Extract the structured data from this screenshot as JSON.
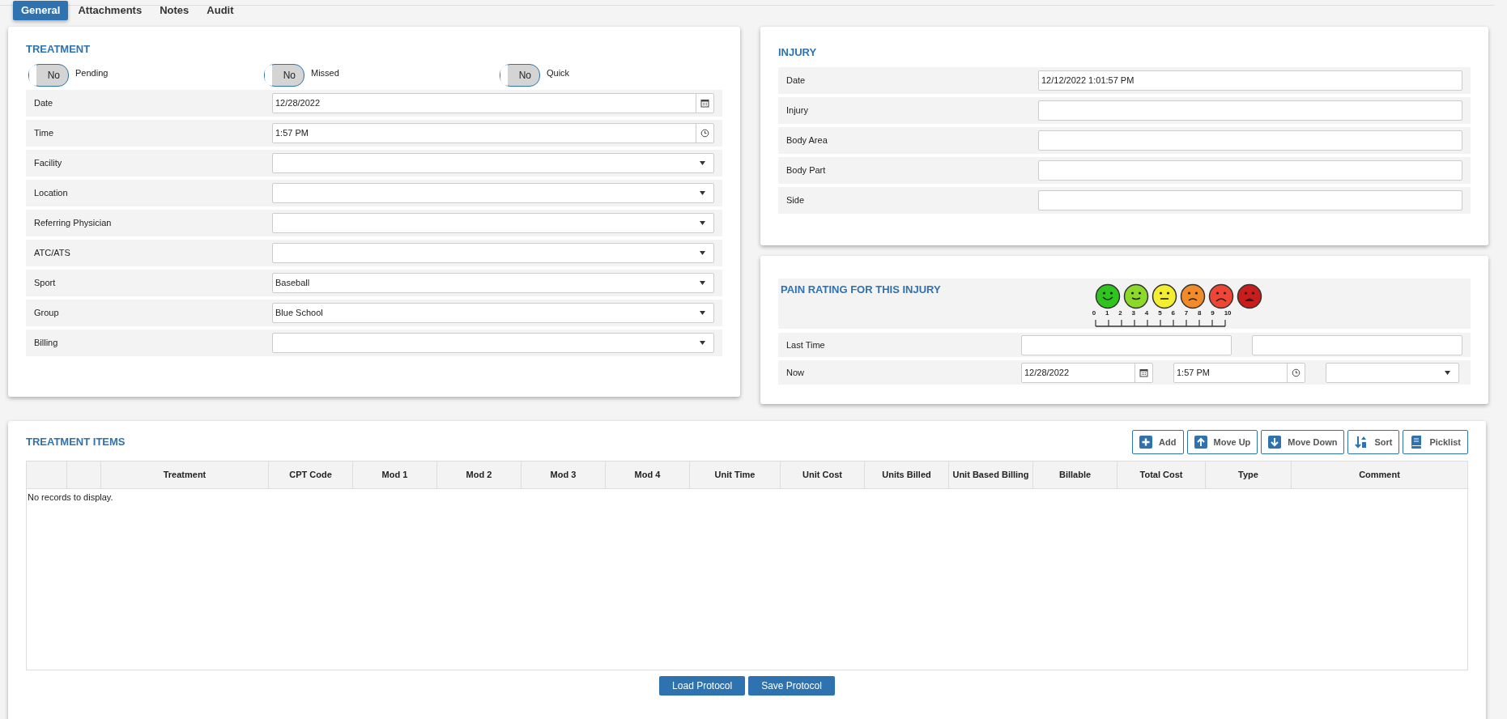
{
  "tabs": [
    {
      "label": "General",
      "selected": true
    },
    {
      "label": "Attachments",
      "selected": false
    },
    {
      "label": "Notes",
      "selected": false
    },
    {
      "label": "Audit",
      "selected": false
    }
  ],
  "treatment": {
    "title": "TREATMENT",
    "toggles": [
      {
        "value": "No",
        "on": false,
        "label": "Pending"
      },
      {
        "value": "No",
        "on": false,
        "label": "Missed"
      },
      {
        "value": "No",
        "on": false,
        "label": "Quick"
      }
    ],
    "fields": [
      {
        "label": "Date",
        "kind": "date",
        "value": "12/28/2022"
      },
      {
        "label": "Time",
        "kind": "time",
        "value": "1:57 PM"
      },
      {
        "label": "Facility",
        "kind": "select"
      },
      {
        "label": "Location",
        "kind": "select"
      },
      {
        "label": "Referring Physician",
        "kind": "select"
      },
      {
        "label": "ATC/ATS",
        "kind": "select"
      },
      {
        "label": "Sport",
        "kind": "select",
        "value": "Baseball"
      },
      {
        "label": "Group",
        "kind": "select",
        "value": "Blue School"
      },
      {
        "label": "Billing",
        "kind": "select"
      }
    ]
  },
  "injury": {
    "title": "INJURY",
    "fields": [
      {
        "label": "Date",
        "value": "12/12/2022 1:01:57 PM"
      },
      {
        "label": "Injury"
      },
      {
        "label": "Body Area"
      },
      {
        "label": "Body Part"
      },
      {
        "label": "Side"
      }
    ]
  },
  "pain": {
    "title": "PAIN RATING FOR THIS INJURY",
    "faces": [
      {
        "kind": "happy",
        "color": "#2fc41e"
      },
      {
        "kind": "smile",
        "color": "#8cd92a"
      },
      {
        "kind": "neutral",
        "color": "#f4ee30"
      },
      {
        "kind": "frown",
        "color": "#f28a27"
      },
      {
        "kind": "sad",
        "color": "#ef4535"
      },
      {
        "kind": "cry",
        "color": "#c91d1d"
      }
    ],
    "scale": [
      "0",
      "1",
      "2",
      "3",
      "4",
      "5",
      "6",
      "7",
      "8",
      "9",
      "10"
    ],
    "rows": [
      {
        "label": "Last Time",
        "inputs": [
          {
            "kind": "text"
          },
          {
            "kind": "text"
          }
        ]
      },
      {
        "label": "Now",
        "inputs": [
          {
            "kind": "date",
            "value": "12/28/2022"
          },
          {
            "kind": "time",
            "value": "1:57 PM"
          },
          {
            "kind": "select"
          }
        ]
      }
    ]
  },
  "items": {
    "title": "TREATMENT ITEMS",
    "buttons": [
      {
        "label": "Add",
        "kind": "add"
      },
      {
        "label": "Move Up",
        "kind": "up"
      },
      {
        "label": "Move Down",
        "kind": "down"
      },
      {
        "label": "Sort",
        "kind": "sort"
      },
      {
        "label": "Picklist",
        "kind": "book"
      }
    ],
    "columns": [
      "Treatment",
      "CPT Code",
      "Mod 1",
      "Mod 2",
      "Mod 3",
      "Mod 4",
      "Unit Time",
      "Unit Cost",
      "Units Billed",
      "Unit Based Billing",
      "Billable",
      "Total Cost",
      "Type",
      "Comment"
    ],
    "empty_text": "No records to display."
  },
  "footer_buttons": [
    "Load Protocol",
    "Save Protocol"
  ]
}
